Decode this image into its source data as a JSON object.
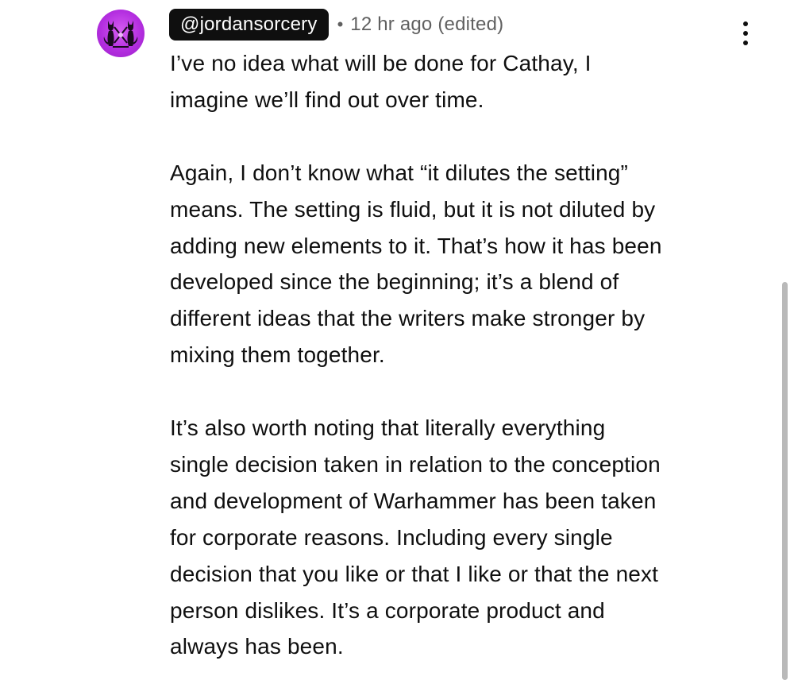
{
  "comment": {
    "author": "@jordansorcery",
    "separator": "•",
    "timestamp": "12 hr ago (edited)",
    "more_icon": "vertical-ellipsis-icon",
    "paragraphs": [
      "I’ve no idea what will be done for Cathay, I\nimagine we’ll find out over time.",
      "Again, I don’t know what “it dilutes the setting”\nmeans. The setting is fluid, but it is not diluted by\nadding new elements to it. That’s how it has been\ndeveloped since the beginning; it’s a blend of\ndifferent ideas that the writers make stronger by\nmixing them together.",
      "It’s also worth noting that literally everything\nsingle decision taken in relation to the conception\nand development of Warhammer has been taken\nfor corporate reasons. Including every single\ndecision that you like or that I like or that the next\nperson dislikes. It’s a corporate product and\nalways has been."
    ]
  },
  "colors": {
    "avatar_bg": "#b42fe0",
    "chip_bg": "#0f0f0f",
    "meta_text": "#606060",
    "scrollbar": "#b9b9b9"
  }
}
